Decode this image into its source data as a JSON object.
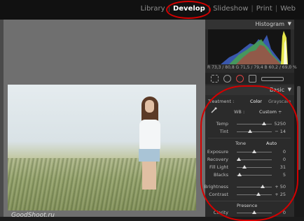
{
  "modules": [
    "Library",
    "Develop",
    "Slideshow",
    "Print",
    "Web"
  ],
  "active_module": "Develop",
  "watermark": "GoodShoot.ru",
  "histogram": {
    "title": "Histogram",
    "readout": "R 73,3 / 80,8  G 71,5 / 79,4  B 60,2 / 69,0 %"
  },
  "basic": {
    "title": "Basic",
    "treatment_label": "Treatment :",
    "color": "Color",
    "grayscale": "Grayscale",
    "wb_label": "WB :",
    "wb_value": "Custom ÷",
    "tone_label": "Tone",
    "auto": "Auto",
    "presence_label": "Presence",
    "sliders": [
      {
        "label": "Temp",
        "value": "5250",
        "level": 0.78
      },
      {
        "label": "Tint",
        "value": "− 14",
        "level": 0.38
      },
      {
        "label": "Exposure",
        "value": "0",
        "level": 0.5
      },
      {
        "label": "Recovery",
        "value": "0",
        "level": 0.05
      },
      {
        "label": "Fill Light",
        "value": "31",
        "level": 0.22
      },
      {
        "label": "Blacks",
        "value": "5",
        "level": 0.08
      },
      {
        "label": "Brightness",
        "value": "+ 50",
        "level": 0.74
      },
      {
        "label": "Contrast",
        "value": "+ 25",
        "level": 0.62
      },
      {
        "label": "Clarity",
        "value": "0",
        "level": 0.5
      }
    ]
  },
  "colors": {
    "highlight": "#d40000",
    "panel_bg": "#2b2b2b"
  }
}
